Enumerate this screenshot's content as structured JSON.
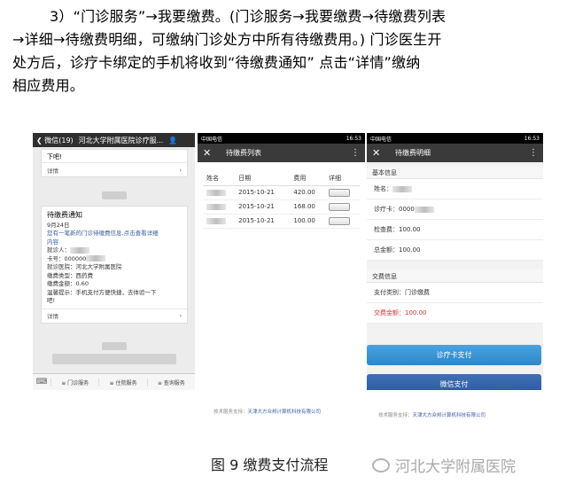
{
  "paragraph": {
    "line1": "3）“门诊服务”→我要缴费。(门诊服务→我要缴费→待缴费列表",
    "line2": "→详细→待缴费明细，可缴纳门诊处方中所有待缴费用。) 门诊医生开",
    "line3": "处方后，诊疗卡绑定的手机将收到“待缴费通知” 点击“详情”缴纳",
    "line4": "相应费用。"
  },
  "phone1": {
    "back_label": "微信(19)",
    "title": "河北大学附属医院诊疗服...",
    "first_card_text": "下吧!",
    "details_label": "详情",
    "notice_title": "待缴费通知",
    "notice_date": "9月24日",
    "notice_line1": "您有一笔新的门诊待缴费信息,点击查看详细",
    "notice_line2": "内容",
    "visitor_label": "就诊人：",
    "card_label": "卡号：000000",
    "hospital_label": "就诊医院：河北大学附属医院",
    "fee_type_label": "缴费类型：西药费",
    "amount_label": "缴费金额：0.60",
    "tip_line1": "温馨提示：手机支付方便快捷，去体验一下",
    "tip_line2": "吧!",
    "menu": [
      "门诊服务",
      "住院服务",
      "查询服务"
    ]
  },
  "phone2": {
    "carrier": "中国电信",
    "time": "16:53",
    "title": "待缴费列表",
    "headers": [
      "姓名",
      "日期",
      "费用",
      "详细"
    ],
    "rows": [
      {
        "date": "2015-10-21",
        "fee": "420.00"
      },
      {
        "date": "2015-10-21",
        "fee": "168.00"
      },
      {
        "date": "2015-10-21",
        "fee": "100.00"
      }
    ],
    "support_label": "技术服务支持：",
    "support_company": "天津大方众邦计算机科技有限公司"
  },
  "phone3": {
    "carrier": "中国电信",
    "time": "16:53",
    "title": "待缴费明细",
    "basic_info_header": "基本信息",
    "name_label": "姓名：",
    "card_label": "诊疗卡：0000",
    "check_fee_label": "检查费：100.00",
    "total_label": "总金额：100.00",
    "payment_header": "交费信息",
    "payment_type_label": "支付类别：门诊缴费",
    "payment_amount_label": "交费金额：100.00",
    "card_pay_button": "诊疗卡支付",
    "wechat_pay_button": "微信支付",
    "support_label": "技术服务支持：",
    "support_company": "天津大方众邦计算机科技有限公司"
  },
  "caption": "图 9  缴费支付流程",
  "watermark": "河北大学附属医院",
  "colors": {
    "accent_blue": "#2f86c8",
    "dark_blue": "#2b5a9c",
    "red": "#e03131",
    "title_bar": "#3a3a3a"
  }
}
